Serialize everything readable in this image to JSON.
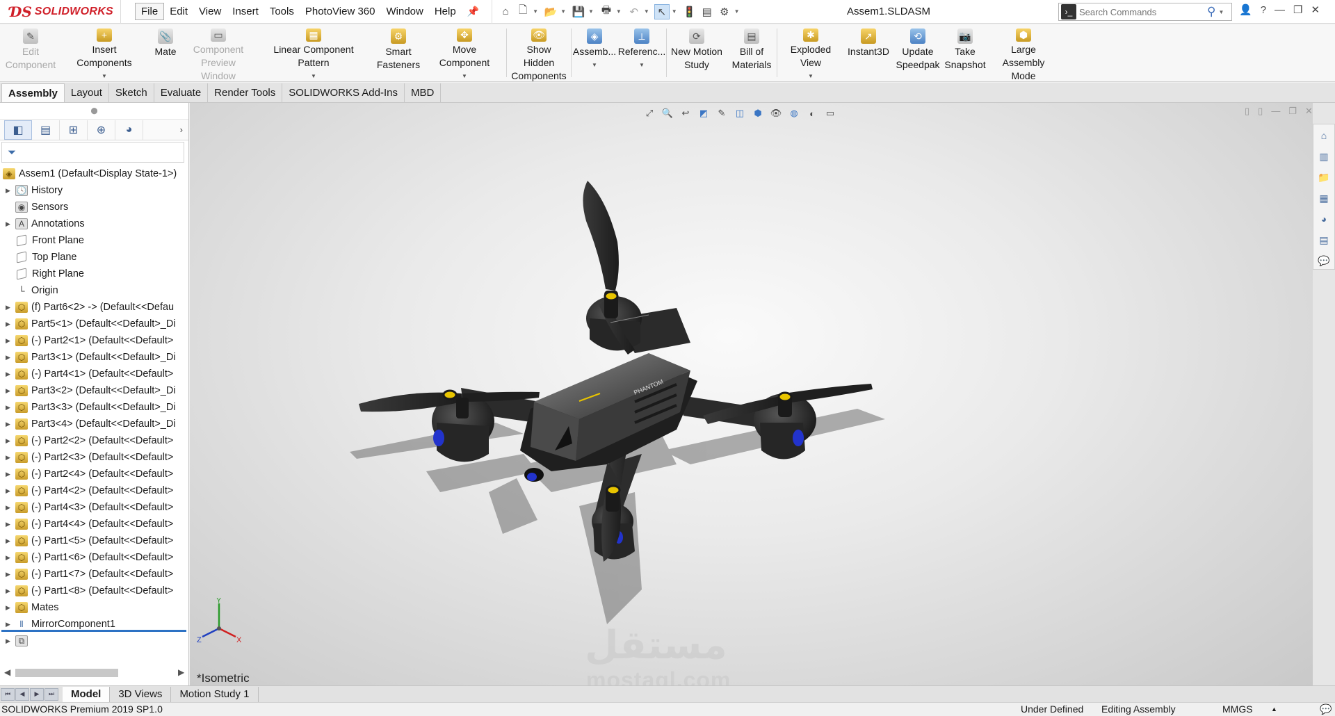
{
  "app": {
    "brand": "SOLIDWORKS",
    "doc_title": "Assem1.SLDASM"
  },
  "menu": [
    "File",
    "Edit",
    "View",
    "Insert",
    "Tools",
    "PhotoView 360",
    "Window",
    "Help"
  ],
  "search": {
    "placeholder": "Search Commands"
  },
  "commands": [
    {
      "label": "Edit Component",
      "icon": "edit-component-icon",
      "enabled": false
    },
    {
      "label": "Insert Components",
      "icon": "insert-components-icon",
      "enabled": true
    },
    {
      "label": "Mate",
      "icon": "mate-icon",
      "enabled": true
    },
    {
      "label": "Component Preview Window",
      "icon": "preview-window-icon",
      "enabled": false
    },
    {
      "label": "Linear Component Pattern",
      "icon": "linear-pattern-icon",
      "enabled": true
    },
    {
      "label": "Smart Fasteners",
      "icon": "smart-fasteners-icon",
      "enabled": true
    },
    {
      "label": "Move Component",
      "icon": "move-component-icon",
      "enabled": true
    },
    {
      "label": "Show Hidden Components",
      "icon": "show-hidden-icon",
      "enabled": true
    },
    {
      "label": "Assemb...",
      "icon": "assembly-features-icon",
      "enabled": true
    },
    {
      "label": "Referenc...",
      "icon": "reference-geometry-icon",
      "enabled": true
    },
    {
      "label": "New Motion Study",
      "icon": "motion-study-icon",
      "enabled": true
    },
    {
      "label": "Bill of Materials",
      "icon": "bom-icon",
      "enabled": true
    },
    {
      "label": "Exploded View",
      "icon": "exploded-view-icon",
      "enabled": true
    },
    {
      "label": "Instant3D",
      "icon": "instant3d-icon",
      "enabled": true
    },
    {
      "label": "Update Speedpak",
      "icon": "speedpak-icon",
      "enabled": true
    },
    {
      "label": "Take Snapshot",
      "icon": "snapshot-icon",
      "enabled": true
    },
    {
      "label": "Large Assembly Mode",
      "icon": "large-assembly-icon",
      "enabled": true
    }
  ],
  "tabs": [
    "Assembly",
    "Layout",
    "Sketch",
    "Evaluate",
    "Render Tools",
    "SOLIDWORKS Add-Ins",
    "MBD"
  ],
  "tree": {
    "root": "Assem1  (Default<Display State-1>)",
    "items": [
      "History",
      "Sensors",
      "Annotations",
      "Front Plane",
      "Top Plane",
      "Right Plane",
      "Origin",
      "(f) Part6<2> -> (Default<<Defau",
      "Part5<1> (Default<<Default>_Di",
      "(-) Part2<1> (Default<<Default>",
      "Part3<1> (Default<<Default>_Di",
      "(-) Part4<1> (Default<<Default>",
      "Part3<2> (Default<<Default>_Di",
      "Part3<3> (Default<<Default>_Di",
      "Part3<4> (Default<<Default>_Di",
      "(-) Part2<2> (Default<<Default>",
      "(-) Part2<3> (Default<<Default>",
      "(-) Part2<4> (Default<<Default>",
      "(-) Part4<2> (Default<<Default>",
      "(-) Part4<3> (Default<<Default>",
      "(-) Part4<4> (Default<<Default>",
      "(-) Part1<5> (Default<<Default>",
      "(-) Part1<6> (Default<<Default>",
      "(-) Part1<7> (Default<<Default>",
      "(-) Part1<8> (Default<<Default>",
      "Mates",
      "MirrorComponent1"
    ]
  },
  "viewport": {
    "view_name": "*Isometric",
    "triad_x": "X",
    "triad_y": "Y",
    "triad_z": "Z",
    "model_label": "PHANTOM",
    "watermark_ar": "مستقل",
    "watermark_en": "mostaql.com"
  },
  "bottom_tabs": [
    "Model",
    "3D Views",
    "Motion Study 1"
  ],
  "status": {
    "product": "SOLIDWORKS Premium 2019 SP1.0",
    "state": "Under Defined",
    "mode": "Editing Assembly",
    "units": "MMGS"
  },
  "colors": {
    "brand_red": "#d0202a",
    "accent_blue": "#2d72c4",
    "prop_yellow": "#e8c400"
  }
}
